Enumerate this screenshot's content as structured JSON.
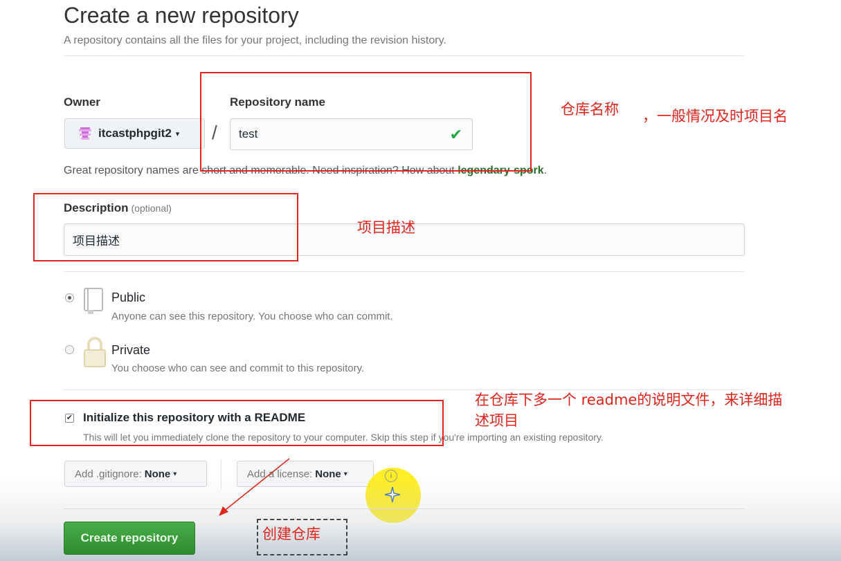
{
  "page": {
    "title": "Create a new repository",
    "subtitle": "A repository contains all the files for your project, including the revision history."
  },
  "owner": {
    "label": "Owner",
    "value": "itcastphpgit2",
    "caret": "▾"
  },
  "separator": "/",
  "repo_name": {
    "label": "Repository name",
    "value": "test",
    "valid_icon": "check-icon"
  },
  "name_hint": {
    "prefix": "Great repository names are short and memorable. Need inspiration? How about ",
    "suggestion": "legendary-spork",
    "suffix": "."
  },
  "description": {
    "label": "Description",
    "optional": "(optional)",
    "value": "项目描述"
  },
  "visibility": {
    "public": {
      "title": "Public",
      "desc": "Anyone can see this repository. You choose who can commit.",
      "selected": true,
      "icon": "repo-book-icon"
    },
    "private": {
      "title": "Private",
      "desc": "You choose who can see and commit to this repository.",
      "selected": false,
      "icon": "lock-icon"
    }
  },
  "readme": {
    "checked": true,
    "label": "Initialize this repository with a README",
    "desc": "This will let you immediately clone the repository to your computer. Skip this step if you're importing an existing repository."
  },
  "gitignore": {
    "prefix": "Add .gitignore:",
    "value": "None",
    "caret": "▾"
  },
  "license": {
    "prefix": "Add a license:",
    "value": "None",
    "caret": "▾"
  },
  "info_icon": "info-icon",
  "create_button": "Create repository",
  "annotations": {
    "repo_name_note": "仓库名称",
    "repo_name_note2": "，一般情况及时项目名",
    "description_note": "项目描述",
    "readme_note_line1": "在仓库下多一个  readme的说明文件，来详细描",
    "readme_note_line2": "述项目",
    "create_note": "创建仓库"
  },
  "colors": {
    "annotation_red": "#e2231a",
    "button_green": "#2f8a2f",
    "check_green": "#28a745",
    "cursor_highlight": "#ffeb00"
  }
}
